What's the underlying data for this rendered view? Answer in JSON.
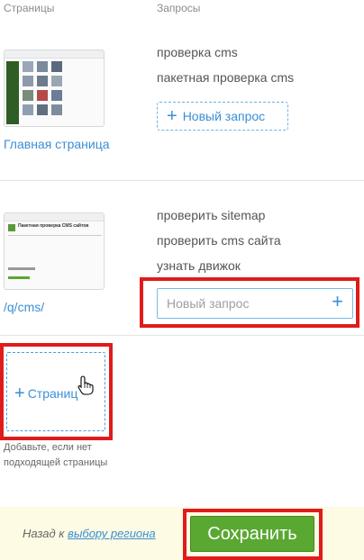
{
  "headers": {
    "pages": "Страницы",
    "queries": "Запросы"
  },
  "rows": [
    {
      "page_link": "Главная страница",
      "queries": [
        "проверка cms",
        "пакетная проверка cms"
      ],
      "new_query_label": "Новый запрос"
    },
    {
      "thumbnail_title": "Пакетная проверка CMS сайтов",
      "page_link": "/q/cms/",
      "queries": [
        "проверить sitemap",
        "проверить cms сайта",
        "узнать движок"
      ],
      "new_query_placeholder": "Новый запрос"
    }
  ],
  "add_page": {
    "label": "Страниц",
    "hint_line1": "Добавьте, если нет",
    "hint_line2": "подходящей страницы"
  },
  "footer": {
    "back_prefix": "Назад к",
    "back_link": "выбору региона",
    "save_label": "Сохранить"
  },
  "colors": {
    "accent": "#3a8fd6",
    "highlight": "#e01b1b",
    "save": "#5aa832",
    "footer_bg": "#fdfbe3"
  },
  "icons": [
    "plus-icon",
    "hand-pointer-icon"
  ]
}
